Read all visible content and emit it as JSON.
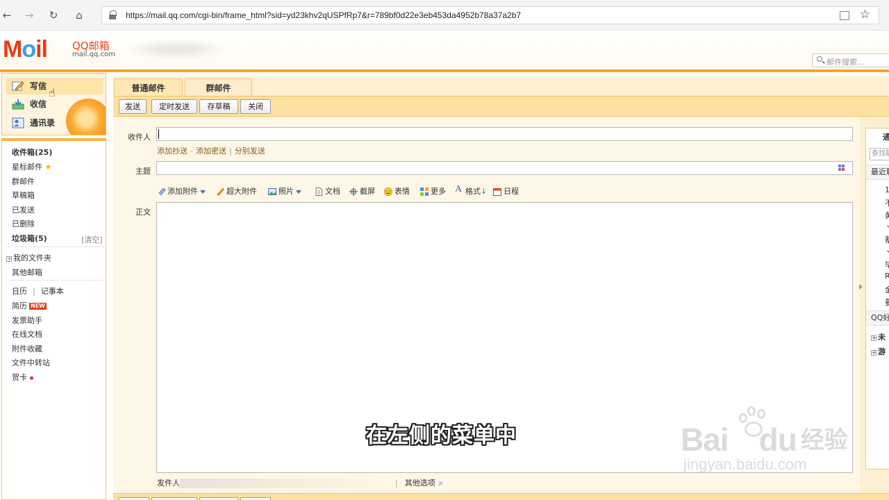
{
  "browser": {
    "url": "https://mail.qq.com/cgi-bin/frame_html?sid=yd23khv2qUSPfRp7&r=789bf0d22e3eb453da4952b78a37a2b7"
  },
  "header": {
    "logo_text": "MOil",
    "logo_cn": "QQ邮箱",
    "logo_domain": "mail.qq.com",
    "search_placeholder": "邮件搜索..."
  },
  "quick_actions": [
    {
      "label": "写信",
      "icon": "pencil-icon"
    },
    {
      "label": "收信",
      "icon": "inbox-icon"
    },
    {
      "label": "通讯录",
      "icon": "contacts-icon"
    }
  ],
  "folders": {
    "inbox": "收件箱(25)",
    "starred": "星标邮件",
    "group_mail": "群邮件",
    "drafts": "草稿箱",
    "sent": "已发送",
    "deleted": "已删除",
    "spam": "垃圾箱(5)",
    "clear": "[清空]",
    "my_folders": "我的文件夹",
    "other_mailboxes": "其他邮箱",
    "calendar": "日历",
    "notebook": "记事本",
    "resume": "简历",
    "new_badge": "NEW",
    "invoice": "发票助手",
    "online_docs": "在线文档",
    "attachments": "附件收藏",
    "file_transfer": "文件中转站",
    "greeting_card": "贺卡"
  },
  "tabs": [
    "普通邮件",
    "群邮件"
  ],
  "toolbar": {
    "send": "发送",
    "scheduled_send": "定时发送",
    "save_draft": "存草稿",
    "close": "关闭"
  },
  "compose": {
    "to_label": "收件人",
    "add_cc": "添加抄送",
    "add_bcc": "添加密送",
    "separate_send": "分别发送",
    "subject_label": "主题",
    "body_label": "正文",
    "tools": [
      "添加附件",
      "超大附件",
      "照片",
      "文档",
      "截屏",
      "表情",
      "更多",
      "格式",
      "日程"
    ],
    "sender_label": "发件人",
    "other_options": "其他选项"
  },
  "right_panel": {
    "title": "通",
    "search_placeholder": "查找联系人",
    "recent_header": "最近联",
    "recent_items": [
      "1",
      "不",
      "黄",
      "丶",
      "蔡",
      "丶",
      "毕",
      "R",
      "金",
      "曼"
    ],
    "qq_header": "QQ好",
    "groups": [
      "未",
      "游"
    ]
  },
  "caption": "在左侧的菜单中",
  "watermark": {
    "brand": "Bai",
    "brand2": "du",
    "cn": "经验",
    "url": "jingyan.baidu.com"
  },
  "colors": {
    "accent_orange": "#f6a623",
    "logo_red": "#e53d16",
    "logo_blue": "#3ba0de",
    "toolbar_bg": "#fce0a0",
    "link_brown": "#8a5a1a"
  }
}
